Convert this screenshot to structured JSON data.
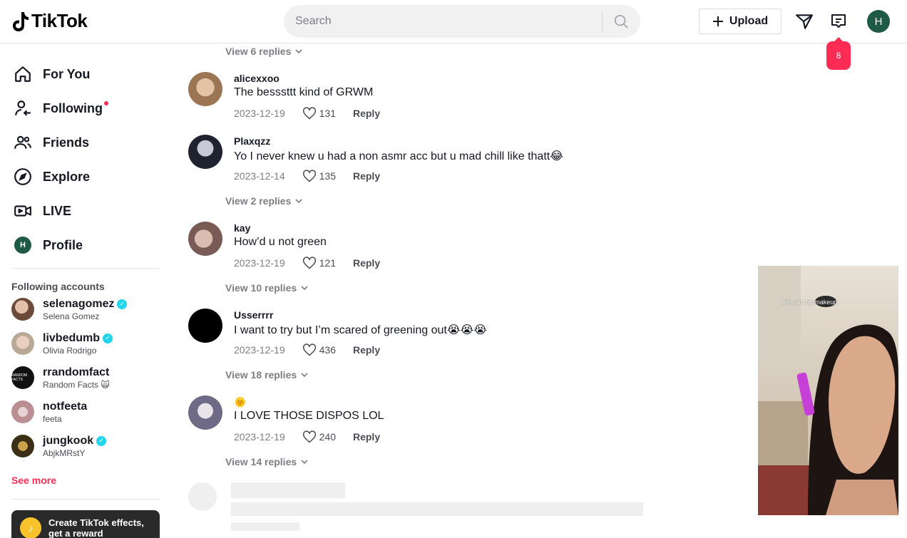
{
  "header": {
    "logo_text": "TikTok",
    "search_placeholder": "Search",
    "upload_label": "Upload",
    "profile_initial": "H",
    "inbox_badge": "8"
  },
  "sidebar": {
    "nav": [
      {
        "label": "For You",
        "icon": "home-icon"
      },
      {
        "label": "Following",
        "icon": "following-icon"
      },
      {
        "label": "Friends",
        "icon": "friends-icon"
      },
      {
        "label": "Explore",
        "icon": "compass-icon"
      },
      {
        "label": "LIVE",
        "icon": "live-icon"
      },
      {
        "label": "Profile",
        "icon": "profile-avatar",
        "initial": "H"
      }
    ],
    "following_title": "Following accounts",
    "accounts": [
      {
        "username": "selenagomez",
        "name": "Selena Gomez",
        "verified": true,
        "color": "#b9897a"
      },
      {
        "username": "livbedumb",
        "name": "Olivia Rodrigo",
        "verified": true,
        "color": "#c7b7a5"
      },
      {
        "username": "rrandomfact",
        "name": "Random Facts 🙀",
        "verified": false,
        "color": "#111111"
      },
      {
        "username": "notfeeta",
        "name": "feeta",
        "verified": false,
        "color": "#c9a6a8"
      },
      {
        "username": "jungkook",
        "name": "AbjkMRstY",
        "verified": true,
        "color": "#6d5a2a"
      }
    ],
    "see_more": "See more",
    "promo_text_1": "Create TikTok effects,",
    "promo_text_2": "get a reward"
  },
  "comments": {
    "top_replies": "View 6 replies",
    "items": [
      {
        "user": "alicexxoo",
        "text": "The besssttt kind of GRWM",
        "date": "2023-12-19",
        "likes": "131",
        "reply": "Reply",
        "avatar_color": "#b08a6a",
        "view_replies": ""
      },
      {
        "user": "Plaxqzz",
        "text": "Yo I never knew u had a non asmr acc but u mad chill like thatt😂",
        "date": "2023-12-14",
        "likes": "135",
        "reply": "Reply",
        "avatar_color": "#2b2f3a",
        "view_replies": "View 2 replies"
      },
      {
        "user": "kay",
        "text": "How’d u not green",
        "date": "2023-12-19",
        "likes": "121",
        "reply": "Reply",
        "avatar_color": "#a58a80",
        "view_replies": "View 10 replies"
      },
      {
        "user": "Usserrrr",
        "text": "I want to try but I’m scared of greening out😭😭😭",
        "date": "2023-12-19",
        "likes": "436",
        "reply": "Reply",
        "avatar_color": "#000000",
        "view_replies": "View 18 replies"
      },
      {
        "user": "🌞",
        "text": "I LOVE THOSE DISPOS LOL",
        "date": "2023-12-19",
        "likes": "240",
        "reply": "Reply",
        "avatar_color": "#8c8fa6",
        "view_replies": "View 14 replies"
      }
    ]
  },
  "mini_player": {
    "caption": "let's do my makeup"
  }
}
